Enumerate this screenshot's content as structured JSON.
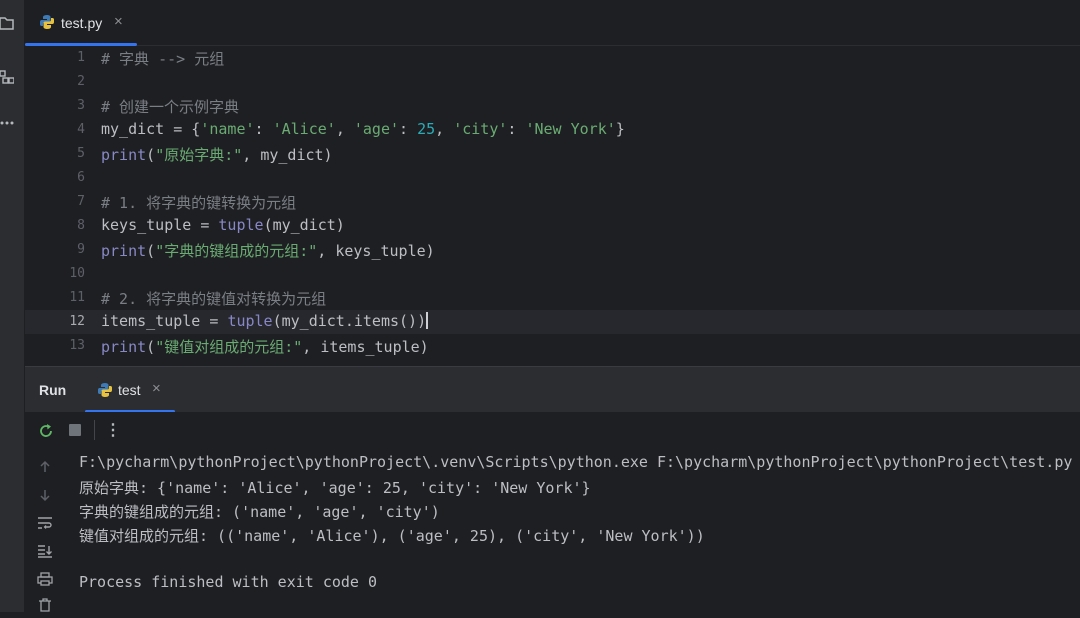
{
  "editor_tab": {
    "label": "test.py",
    "close": "×"
  },
  "code_lines": [
    {
      "n": "1",
      "comment": "# 字典 --> 元组"
    },
    {
      "n": "2"
    },
    {
      "n": "3",
      "comment": "# 创建一个示例字典"
    },
    {
      "n": "4",
      "var": "my_dict = {",
      "k1": "'name'",
      "c1": ": ",
      "v1": "'Alice'",
      "s1": ", ",
      "k2": "'age'",
      "c2": ": ",
      "v2": "25",
      "s2": ", ",
      "k3": "'city'",
      "c3": ": ",
      "v3": "'New York'",
      "end": "}"
    },
    {
      "n": "5",
      "fn": "print",
      "open": "(",
      "str": "\"原始字典:\"",
      "rest": ", my_dict)"
    },
    {
      "n": "6"
    },
    {
      "n": "7",
      "comment": "# 1. 将字典的键转换为元组"
    },
    {
      "n": "8",
      "var": "keys_tuple = ",
      "fn": "tuple",
      "rest": "(my_dict)"
    },
    {
      "n": "9",
      "fn": "print",
      "open": "(",
      "str": "\"字典的键组成的元组:\"",
      "rest": ", keys_tuple)"
    },
    {
      "n": "10"
    },
    {
      "n": "11",
      "comment": "# 2. 将字典的键值对转换为元组"
    },
    {
      "n": "12",
      "var": "items_tuple = ",
      "fn": "tuple",
      "rest": "(my_dict.items())"
    },
    {
      "n": "13",
      "fn": "print",
      "open": "(",
      "str": "\"键值对组成的元组:\"",
      "rest": ", items_tuple)"
    }
  ],
  "run_panel": {
    "title": "Run",
    "tab_label": "test",
    "tab_close": "×",
    "more": "⋮",
    "output": [
      "F:\\pycharm\\pythonProject\\pythonProject\\.venv\\Scripts\\python.exe F:\\pycharm\\pythonProject\\pythonProject\\test.py",
      "原始字典: {'name': 'Alice', 'age': 25, 'city': 'New York'}",
      "字典的键组成的元组: ('name', 'age', 'city')",
      "键值对组成的元组: (('name', 'Alice'), ('age', 25), ('city', 'New York'))",
      "",
      "Process finished with exit code 0"
    ]
  },
  "icons": {
    "folder": "folder-icon",
    "structure": "structure-icon",
    "more": "more-icon",
    "python_file": "python-file-icon",
    "rerun": "rerun-icon",
    "stop": "stop-icon",
    "scroll_up": "arrow-up-icon",
    "scroll_down": "arrow-down-icon",
    "soft_wrap": "soft-wrap-icon",
    "scroll_to_end": "scroll-to-end-icon",
    "print": "print-icon",
    "trash": "trash-icon"
  },
  "colors": {
    "background": "#1e1f22",
    "panel": "#2b2d30",
    "accent": "#3574f0",
    "string": "#6aab73",
    "number": "#2aacb8",
    "comment": "#7a7e85",
    "builtin": "#8888c6",
    "text": "#bcbec4",
    "rerun_green": "#5fb865"
  }
}
